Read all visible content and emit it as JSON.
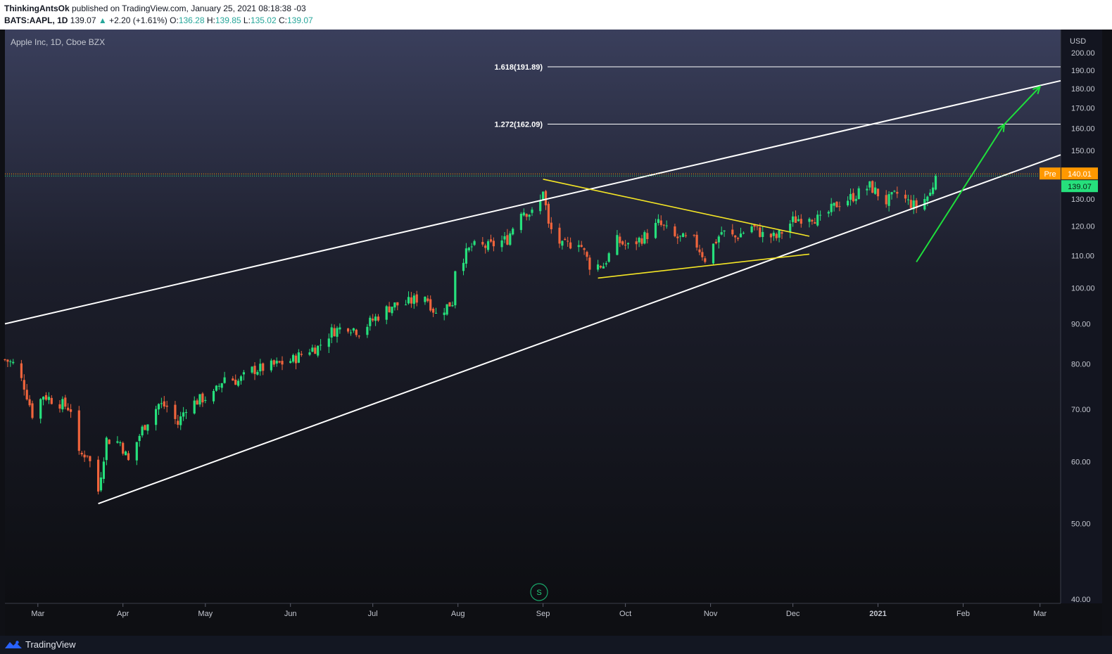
{
  "header": {
    "author": "ThinkingAntsOk",
    "published_text": " published on TradingView.com, January 25, 2021 08:18:38 -03",
    "symbol_tf": "BATS:AAPL, 1D",
    "last": "139.07",
    "up_arrow": "▲",
    "change": "+2.20 (+1.61%)",
    "o_label": "O:",
    "o_value": "136.28",
    "h_label": "H:",
    "h_value": "139.85",
    "l_label": "L:",
    "l_value": "135.02",
    "c_label": "C:",
    "c_value": "139.07"
  },
  "chart": {
    "title": "Apple Inc, 1D, Cboe BZX",
    "currency": "USD",
    "fib_labels": [
      "1.618(191.89)",
      "1.272(162.09)"
    ],
    "pre_label": "Pre",
    "pre_price": "140.01",
    "last_price": "139.07",
    "s_marker": "S"
  },
  "colors": {
    "up": "#26e07c",
    "down": "#f0643c",
    "trendline": "#ffffff",
    "triangle": "#f5e625",
    "projection": "#1ee03c",
    "pre_badge": "#ff9800",
    "last_badge": "#26e07c"
  },
  "footer": {
    "brand": "TradingView",
    "icon": "tradingview-logo-icon"
  },
  "chart_data": {
    "type": "candlestick",
    "symbol": "BATS:AAPL",
    "interval": "1D",
    "y_scale": "log",
    "ylim": [
      40,
      200
    ],
    "y_ticks": [
      "200.00",
      "190.00",
      "180.00",
      "170.00",
      "160.00",
      "150.00",
      "140.00",
      "130.00",
      "120.00",
      "110.00",
      "100.00",
      "90.00",
      "80.00",
      "70.00",
      "60.00",
      "50.00",
      "40.00"
    ],
    "x_ticks": [
      "Mar",
      "Apr",
      "May",
      "Jun",
      "Jul",
      "Aug",
      "Sep",
      "Oct",
      "Nov",
      "Dec",
      "2021",
      "Feb",
      "Mar"
    ],
    "x_tick_dates": [
      "2020-03-01",
      "2020-04-01",
      "2020-05-01",
      "2020-06-01",
      "2020-07-01",
      "2020-08-01",
      "2020-09-01",
      "2020-10-01",
      "2020-11-01",
      "2020-12-01",
      "2021-01-01",
      "2021-02-01",
      "2021-03-01"
    ],
    "close_series": [
      [
        "2020-02-18",
        81.0
      ],
      [
        "2020-02-21",
        80.0
      ],
      [
        "2020-02-25",
        75.0
      ],
      [
        "2020-02-28",
        69.0
      ],
      [
        "2020-03-03",
        73.0
      ],
      [
        "2020-03-06",
        72.0
      ],
      [
        "2020-03-10",
        71.0
      ],
      [
        "2020-03-13",
        70.0
      ],
      [
        "2020-03-16",
        61.0
      ],
      [
        "2020-03-19",
        61.5
      ],
      [
        "2020-03-23",
        55.0
      ],
      [
        "2020-03-26",
        64.0
      ],
      [
        "2020-03-31",
        63.5
      ],
      [
        "2020-04-03",
        60.0
      ],
      [
        "2020-04-08",
        66.0
      ],
      [
        "2020-04-14",
        71.0
      ],
      [
        "2020-04-17",
        70.5
      ],
      [
        "2020-04-21",
        67.0
      ],
      [
        "2020-04-24",
        70.5
      ],
      [
        "2020-04-29",
        72.0
      ],
      [
        "2020-05-04",
        73.0
      ],
      [
        "2020-05-08",
        77.0
      ],
      [
        "2020-05-13",
        76.0
      ],
      [
        "2020-05-18",
        78.5
      ],
      [
        "2020-05-22",
        79.0
      ],
      [
        "2020-05-28",
        80.0
      ],
      [
        "2020-06-02",
        81.0
      ],
      [
        "2020-06-08",
        83.5
      ],
      [
        "2020-06-11",
        84.0
      ],
      [
        "2020-06-16",
        88.0
      ],
      [
        "2020-06-22",
        89.5
      ],
      [
        "2020-06-26",
        88.0
      ],
      [
        "2020-07-01",
        91.0
      ],
      [
        "2020-07-08",
        95.0
      ],
      [
        "2020-07-13",
        95.5
      ],
      [
        "2020-07-20",
        98.0
      ],
      [
        "2020-07-24",
        92.5
      ],
      [
        "2020-07-30",
        96.0
      ],
      [
        "2020-07-31",
        106.0
      ],
      [
        "2020-08-06",
        113.0
      ],
      [
        "2020-08-12",
        113.0
      ],
      [
        "2020-08-19",
        115.5
      ],
      [
        "2020-08-24",
        126.0
      ],
      [
        "2020-08-28",
        124.5
      ],
      [
        "2020-08-31",
        129.0
      ],
      [
        "2020-09-01",
        134.0
      ],
      [
        "2020-09-03",
        120.0
      ],
      [
        "2020-09-08",
        113.0
      ],
      [
        "2020-09-14",
        115.0
      ],
      [
        "2020-09-18",
        107.0
      ],
      [
        "2020-09-23",
        107.0
      ],
      [
        "2020-09-28",
        115.0
      ],
      [
        "2020-10-02",
        113.0
      ],
      [
        "2020-10-09",
        117.0
      ],
      [
        "2020-10-13",
        121.0
      ],
      [
        "2020-10-19",
        116.0
      ],
      [
        "2020-10-26",
        115.0
      ],
      [
        "2020-10-30",
        109.0
      ],
      [
        "2020-11-05",
        118.0
      ],
      [
        "2020-11-10",
        116.0
      ],
      [
        "2020-11-16",
        120.0
      ],
      [
        "2020-11-20",
        117.0
      ],
      [
        "2020-11-25",
        116.0
      ],
      [
        "2020-12-01",
        122.0
      ],
      [
        "2020-12-07",
        124.0
      ],
      [
        "2020-12-11",
        122.0
      ],
      [
        "2020-12-17",
        128.0
      ],
      [
        "2020-12-23",
        131.0
      ],
      [
        "2020-12-29",
        135.0
      ],
      [
        "2021-01-04",
        129.0
      ],
      [
        "2021-01-08",
        132.0
      ],
      [
        "2021-01-12",
        128.8
      ],
      [
        "2021-01-15",
        127.0
      ],
      [
        "2021-01-20",
        132.0
      ],
      [
        "2021-01-22",
        139.07
      ]
    ],
    "overlays": {
      "channel_upper": [
        [
          "2020-02-18",
          90.0
        ],
        [
          "2021-03-08",
          184.0
        ]
      ],
      "channel_lower": [
        [
          "2020-03-23",
          53.0
        ],
        [
          "2021-02-15",
          139.0
        ]
      ],
      "triangle_upper": [
        [
          "2020-09-01",
          137.8
        ],
        [
          "2020-12-07",
          116.5
        ]
      ],
      "triangle_lower": [
        [
          "2020-09-21",
          103.0
        ],
        [
          "2020-12-07",
          110.5
        ]
      ],
      "fib_1_618": 191.89,
      "fib_1_272": 162.09,
      "projection_arrow": [
        [
          "2021-01-15",
          108.0
        ],
        [
          "2021-02-16",
          162.0
        ],
        [
          "2021-03-01",
          181.0
        ]
      ]
    }
  }
}
